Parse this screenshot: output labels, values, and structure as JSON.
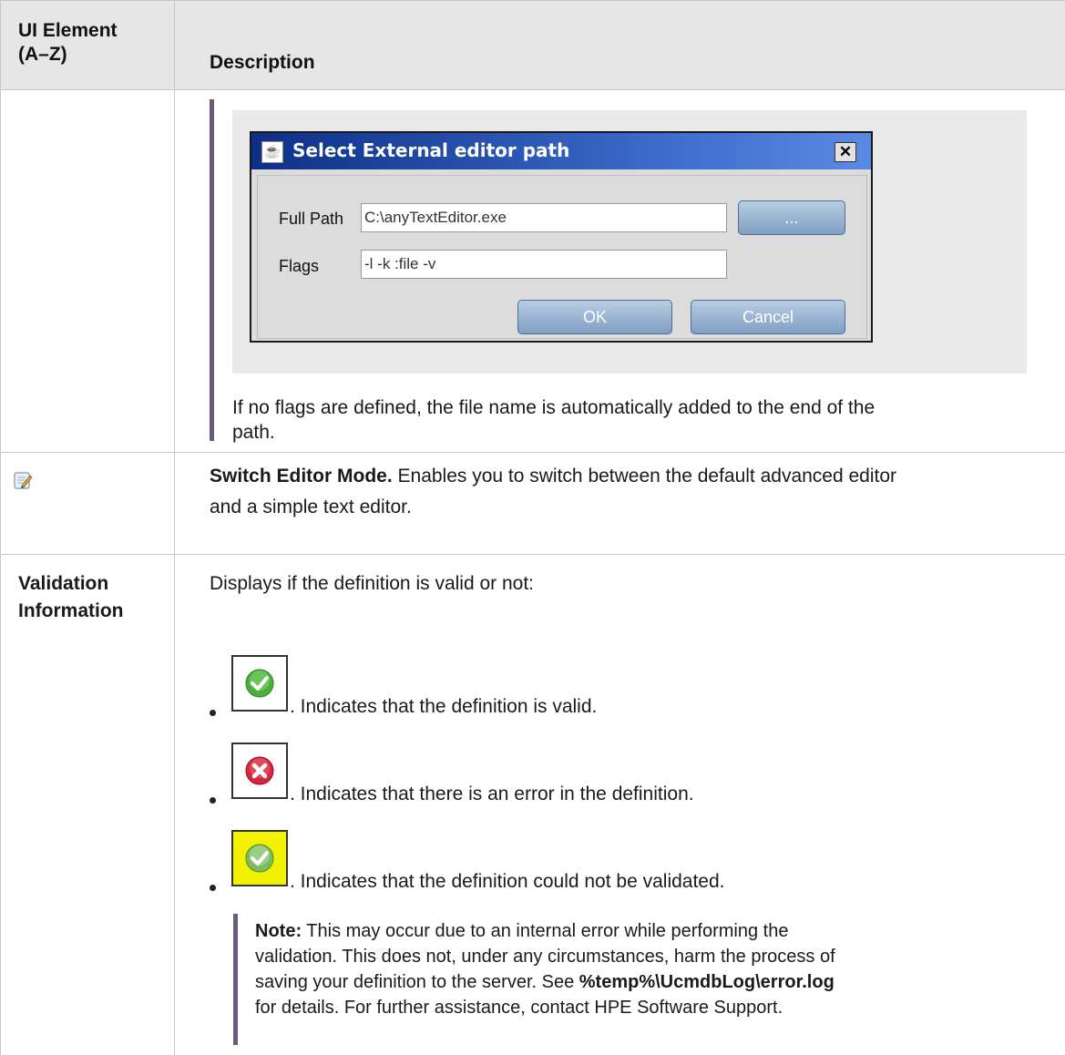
{
  "header": {
    "col1": "UI Element\n(A–Z)",
    "col1_line1": "UI Element",
    "col1_line2": "(A–Z)",
    "col2": "Description"
  },
  "row1": {
    "dialog": {
      "title": "Select External editor path",
      "full_path_label": "Full Path",
      "full_path_value": "C:\\anyTextEditor.exe",
      "browse_button": "...",
      "flags_label": "Flags",
      "flags_value": "-l -k :file -v",
      "ok_button": "OK",
      "cancel_button": "Cancel"
    },
    "note_line1": "If no flags are defined, the file name is automatically added to the end of the",
    "note_line2": "path."
  },
  "row2": {
    "icon": "edit-mode-icon",
    "title": "Switch Editor Mode.",
    "desc_line1": " Enables you to switch between the default advanced editor",
    "desc_line2": "and a simple text editor."
  },
  "row3": {
    "element_line1": "Validation",
    "element_line2": "Information",
    "intro": "Displays if the definition is valid or not:",
    "items": [
      {
        "icon": "valid-check-icon",
        "text": ". Indicates that the definition is valid."
      },
      {
        "icon": "error-x-icon",
        "text": ". Indicates that there is an error in the definition."
      },
      {
        "icon": "not-validated-icon",
        "text": ". Indicates that the definition could not be validated."
      }
    ],
    "note": {
      "label": "Note:",
      "line1": "  This may occur due to an internal error while performing the",
      "line2": "validation. This does not, under any circumstances, harm the process of",
      "line3_pre": "saving your definition to the server. See ",
      "line3_bold": "%temp%\\UcmdbLog\\error.log",
      "line4": "for details. For further assistance, contact HPE Software Support."
    }
  },
  "colors": {
    "header_bg": "#e6e6e6",
    "grid": "#c8c8c8",
    "note_bar": "#6b5b7b",
    "valid_green": "#4caf3a",
    "error_red": "#d7263d",
    "warning_yellow": "#f2f200"
  }
}
